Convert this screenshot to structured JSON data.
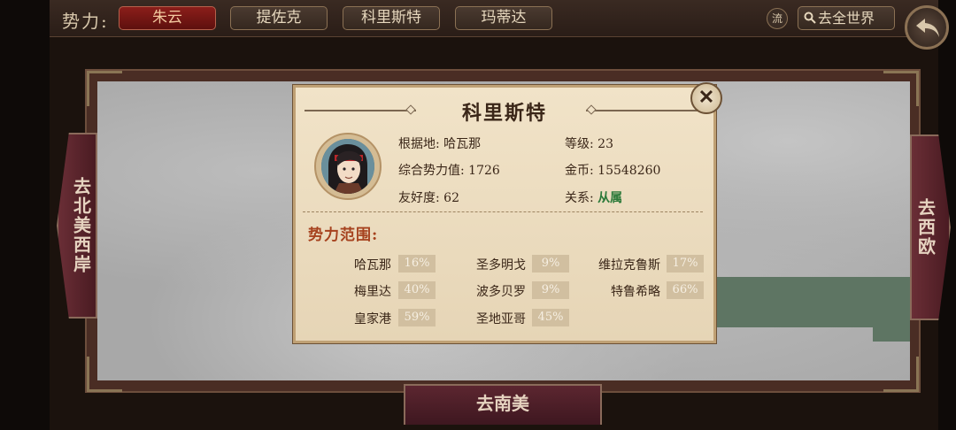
{
  "top_bar": {
    "faction_label": "势力:",
    "tabs": [
      {
        "label": "朱云",
        "active": true
      },
      {
        "label": "提佐克",
        "active": false
      },
      {
        "label": "科里斯特",
        "active": false
      },
      {
        "label": "玛蒂达",
        "active": false
      }
    ],
    "liu_label": "流",
    "world_button": "去全世界"
  },
  "nav": {
    "left": "去北美西岸",
    "right": "去西欧",
    "bottom": "去南美"
  },
  "popup": {
    "title": "科里斯特",
    "base_label": "根据地:",
    "base_value": "哈瓦那",
    "level_label": "等级:",
    "level_value": "23",
    "power_label": "综合势力值:",
    "power_value": "1726",
    "gold_label": "金币:",
    "gold_value": "15548260",
    "friendship_label": "友好度:",
    "friendship_value": "62",
    "relation_label": "关系:",
    "relation_value": "从属",
    "scope_title": "势力范围:",
    "regions": [
      {
        "name": "哈瓦那",
        "pct": "16%"
      },
      {
        "name": "圣多明戈",
        "pct": "9%"
      },
      {
        "name": "维拉克鲁斯",
        "pct": "17%"
      },
      {
        "name": "梅里达",
        "pct": "40%"
      },
      {
        "name": "波多贝罗",
        "pct": "9%"
      },
      {
        "name": "特鲁希略",
        "pct": "66%"
      },
      {
        "name": "皇家港",
        "pct": "59%"
      },
      {
        "name": "圣地亚哥",
        "pct": "45%"
      }
    ]
  },
  "colors": {
    "active_tab": "#8b1e1a",
    "relation_green": "#2d7a3a",
    "scope_title": "#a6421e"
  }
}
